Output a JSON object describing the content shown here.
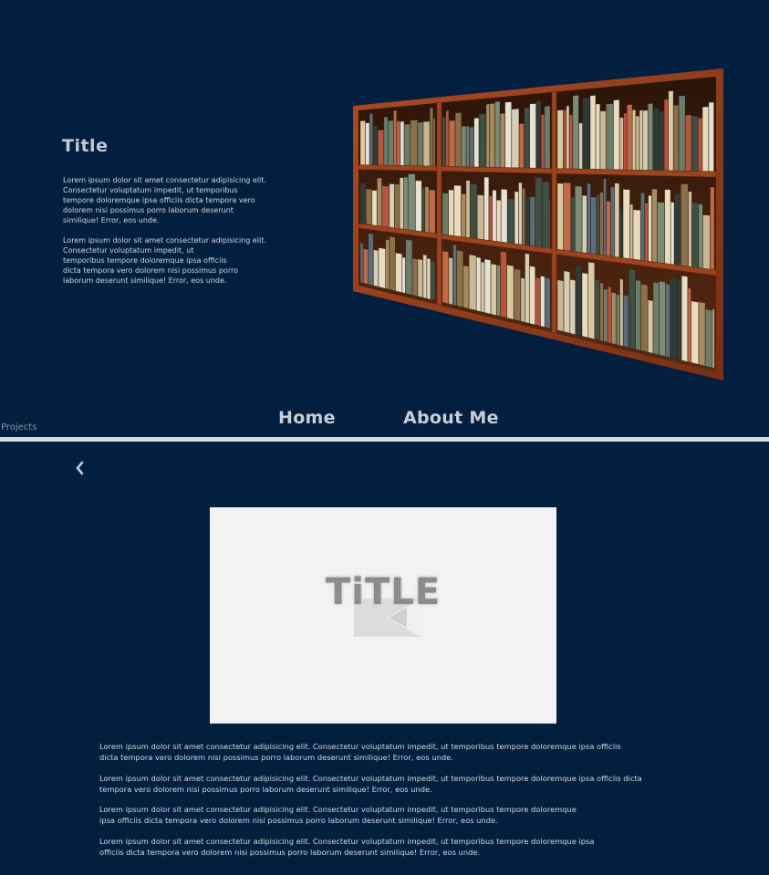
{
  "hero": {
    "title": "Title",
    "paragraphs": [
      "Lorem ipsum dolor sit amet consectetur adipisicing elit.\nConsectetur voluptatum impedit, ut temporibus\ntempore doloremque ipsa officiis dicta tempora vero\ndolorem nisi possimus porro laborum deserunt\nsimilique! Error, eos unde.",
      "Lorem ipsum dolor sit amet consectetur adipisicing elit.\nConsectetur voluptatum impedit, ut\ntemporibus tempore doloremque ipsa officiis\ndicta tempora vero dolorem nisi possimus porro\nlaborum deserunt similique! Error, eos unde."
    ]
  },
  "nav": {
    "projects": "Projects",
    "home": "Home",
    "about": "About Me"
  },
  "media": {
    "title": "TiTLE"
  },
  "icons": {
    "back": "chevron-left-icon",
    "play": "play-icon"
  },
  "body": {
    "paragraphs": [
      "Lorem ipsum dolor sit amet consectetur adipisicing elit. Consectetur voluptatum impedit, ut temporibus tempore doloremque ipsa officiis\ndicta tempora vero dolorem nisi possimus porro laborum deserunt similique! Error, eos unde.",
      "Lorem ipsum dolor sit amet consectetur adipisicing elit. Consectetur voluptatum impedit, ut temporibus tempore doloremque ipsa officiis dicta\ntempora vero dolorem nisi possimus porro laborum deserunt similique! Error, eos unde.",
      "Lorem ipsum dolor sit amet consectetur adipisicing elit. Consectetur voluptatum impedit, ut temporibus tempore doloremque\nipsa officiis dicta tempora vero dolorem nisi possimus porro laborum deserunt similique! Error, eos unde.",
      "Lorem ipsum dolor sit amet consectetur adipisicing elit. Consectetur voluptatum impedit, ut temporibus tempore doloremque ipsa\nofficiis dicta tempora vero dolorem nisi possimus porro laborum deserunt similique! Error, eos unde."
    ]
  },
  "colors": {
    "background": "#021f3f",
    "divider": "#d9dde1",
    "text": "#d2d7de",
    "shelf_wood": "#8e3a18",
    "card": "#f2f2f2"
  }
}
